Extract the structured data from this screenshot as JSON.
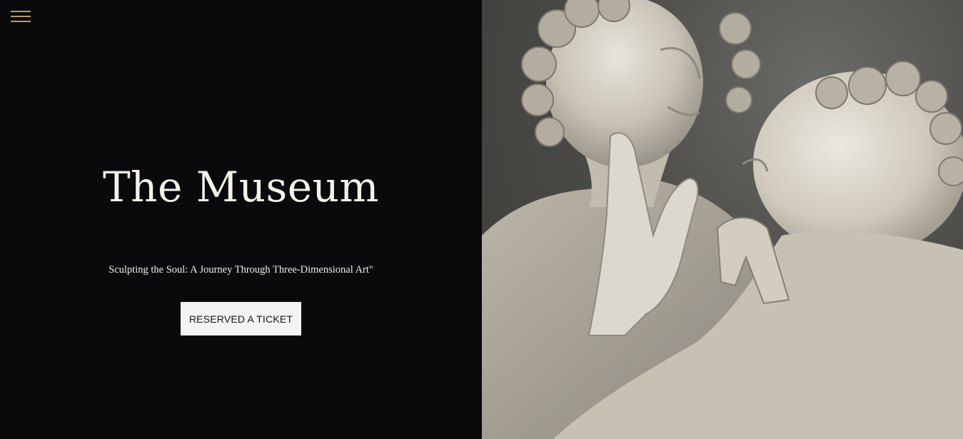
{
  "hero": {
    "title": "The Museum",
    "subtitle": "Sculpting the Soul: A Journey Through Three-Dimensional Art\"",
    "cta_label": "RESERVED A TICKET"
  },
  "icons": {
    "menu": "hamburger-menu-icon"
  },
  "colors": {
    "left_background": "#0a0a0d",
    "menu_accent": "#b79a5b",
    "title_text": "#f4f1ea",
    "button_background": "#f3f3f3",
    "button_text": "#141414"
  }
}
